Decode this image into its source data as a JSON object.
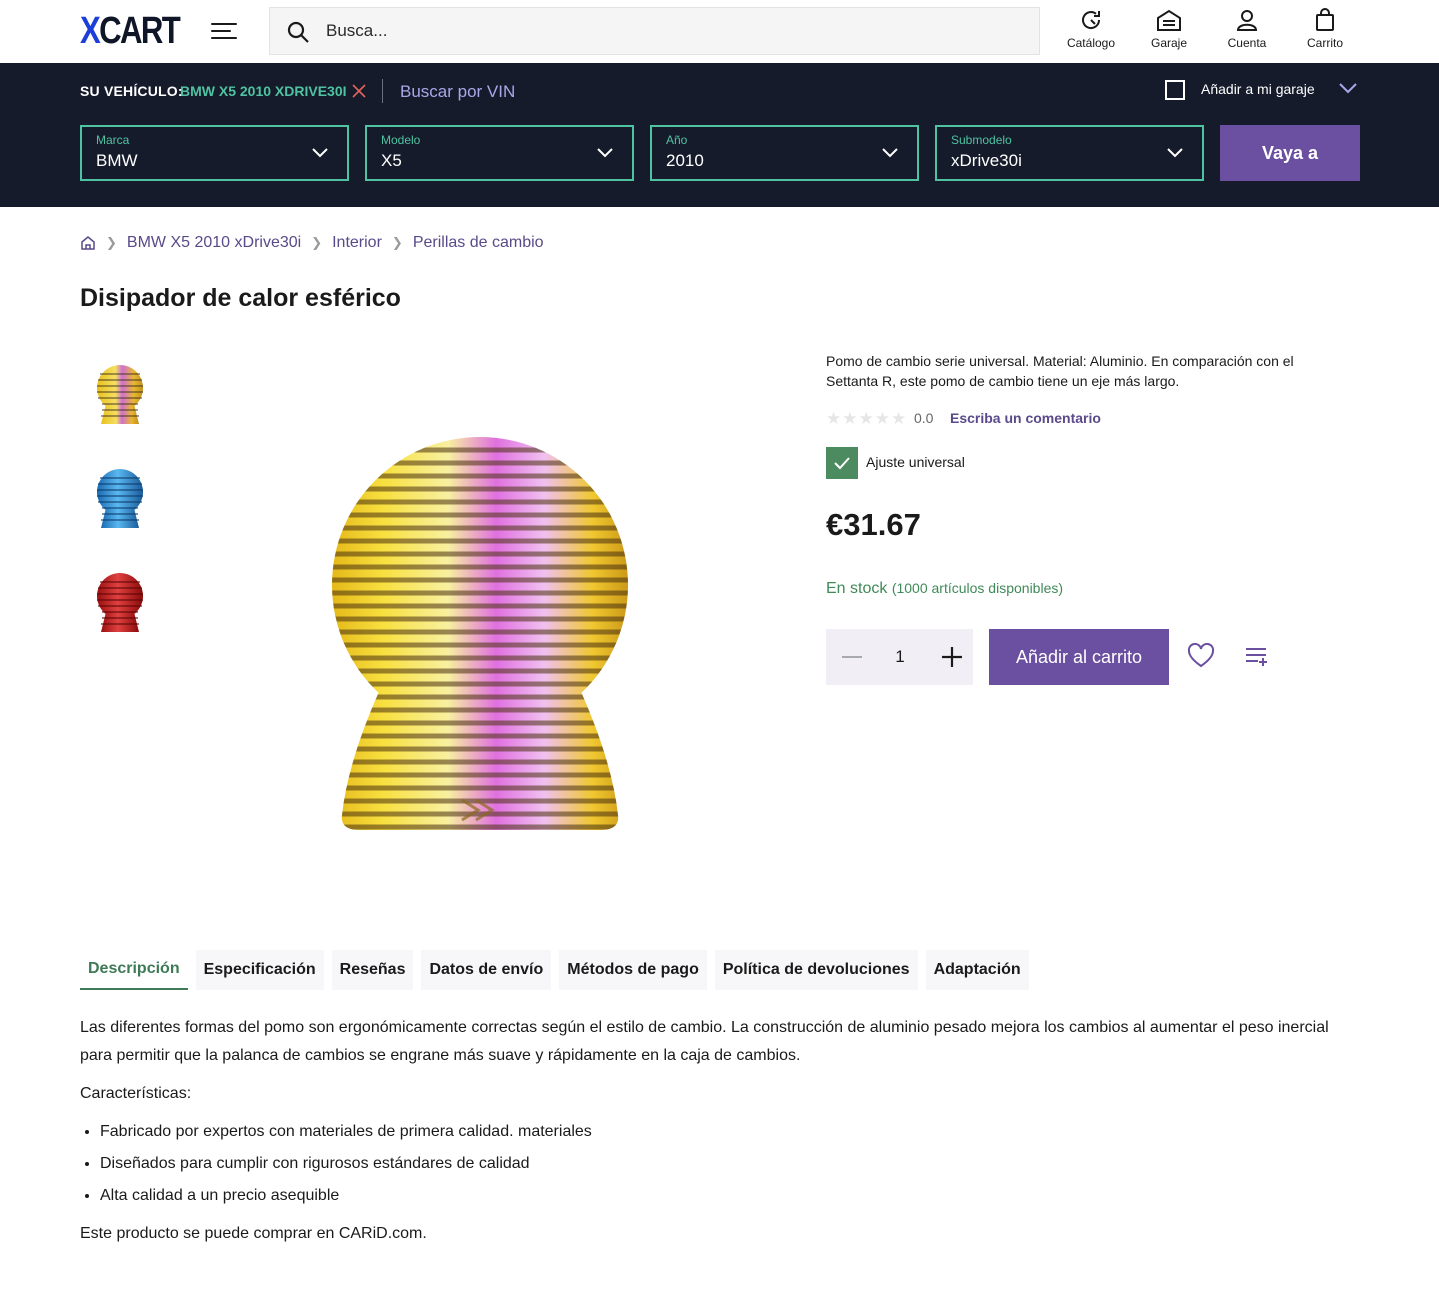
{
  "header": {
    "logo_x": "X",
    "logo_cart": "CART",
    "search_placeholder": "Busca...",
    "links": [
      {
        "label": "Catálogo",
        "icon": "catalog-icon"
      },
      {
        "label": "Garaje",
        "icon": "garage-icon"
      },
      {
        "label": "Cuenta",
        "icon": "account-icon"
      },
      {
        "label": "Carrito",
        "icon": "cart-icon"
      }
    ]
  },
  "vehicle_bar": {
    "label": "SU VEHÍCULO:",
    "value": "BMW X5 2010 XDRIVE30I",
    "vin_link": "Buscar por VIN",
    "garage_label": "Añadir a mi garaje",
    "selects": [
      {
        "label": "Marca",
        "value": "BMW"
      },
      {
        "label": "Modelo",
        "value": "X5"
      },
      {
        "label": "Año",
        "value": "2010"
      },
      {
        "label": "Submodelo",
        "value": "xDrive30i"
      }
    ],
    "go_button": "Vaya a",
    "accent_color": "#4fc3a1",
    "background": "#151b2b"
  },
  "breadcrumb": [
    "BMW X5 2010 xDrive30i",
    "Interior",
    "Perillas de cambio"
  ],
  "product": {
    "title": "Disipador de calor esférico",
    "short_description": "Pomo de cambio serie universal. Material: Aluminio. En comparación con el Settanta R, este pomo de cambio tiene un eje más largo.",
    "rating": "0.0",
    "review_link": "Escriba un comentario",
    "fit_label": "Ajuste universal",
    "price": "€31.67",
    "stock_status": "En stock",
    "stock_qty": "(1000 artículos disponibles)",
    "quantity": "1",
    "add_to_cart": "Añadir al carrito",
    "thumbnails": [
      "neochrome",
      "blue",
      "red"
    ],
    "brand_color": "#6b4fa0"
  },
  "tabs": [
    {
      "label": "Descripción",
      "active": true
    },
    {
      "label": "Especificación"
    },
    {
      "label": "Reseñas"
    },
    {
      "label": "Datos de envío"
    },
    {
      "label": "Métodos de pago"
    },
    {
      "label": "Política de devoluciones"
    },
    {
      "label": "Adaptación"
    }
  ],
  "description": {
    "paragraph": "Las diferentes formas del pomo son ergonómicamente correctas según el estilo de cambio. La construcción de aluminio pesado mejora los cambios al aumentar el peso inercial para permitir que la palanca de cambios se engrane más suave y rápidamente en la caja de cambios.",
    "features_title": "Características:",
    "features": [
      "Fabricado por expertos con materiales de primera calidad. materiales",
      "Diseñados para cumplir con rigurosos estándares de calidad",
      "Alta calidad a un precio asequible"
    ],
    "footer": "Este producto se puede comprar en CARiD.com."
  }
}
